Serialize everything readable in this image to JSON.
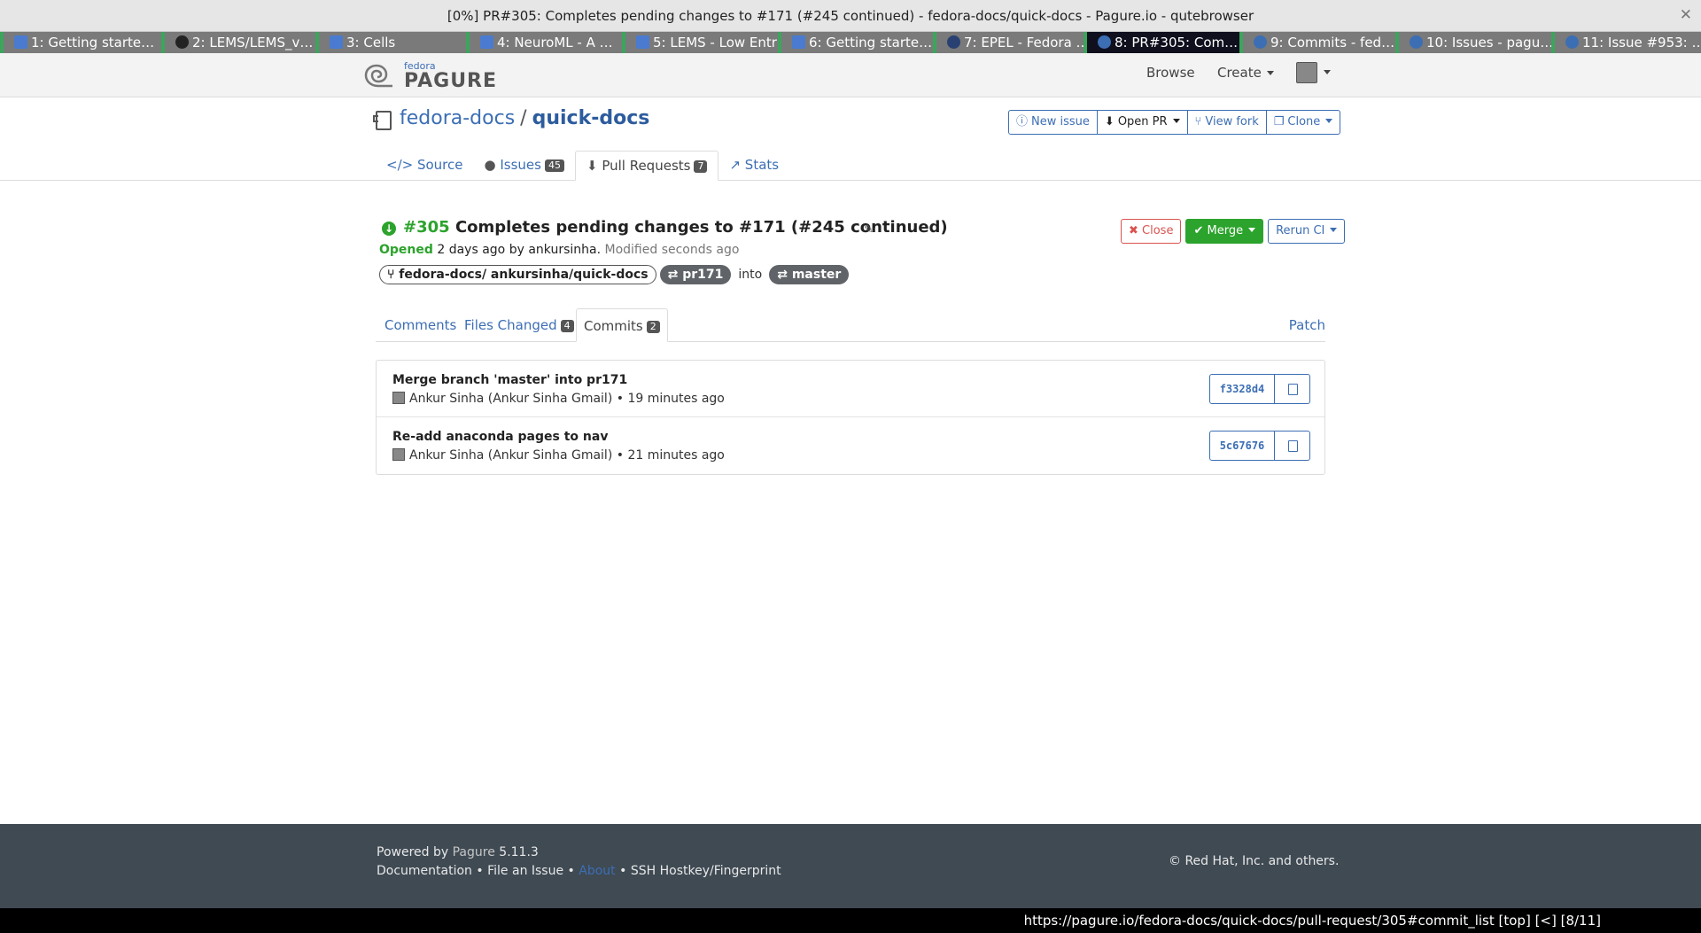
{
  "window": {
    "title": "[0%] PR#305: Completes pending changes to #171 (#245 continued) - fedora-docs/quick-docs - Pagure.io - qutebrowser",
    "close_glyph": "✕"
  },
  "tabs": [
    {
      "label": "1: Getting starte…",
      "icon": "neuroml-icon",
      "color": "#4a7bd0",
      "active": false
    },
    {
      "label": "2: LEMS/LEMS_v…",
      "icon": "github-icon",
      "color": "#222222",
      "active": false
    },
    {
      "label": "3: Cells",
      "icon": "neuroml-icon",
      "color": "#4a7bd0",
      "active": false
    },
    {
      "label": "4: NeuroML - A …",
      "icon": "neuroml-icon",
      "color": "#4a7bd0",
      "active": false
    },
    {
      "label": "5: LEMS - Low Entr…",
      "icon": "neuroml-icon",
      "color": "#4a7bd0",
      "active": false
    },
    {
      "label": "6: Getting starte…",
      "icon": "neuroml-icon",
      "color": "#4a7bd0",
      "active": false
    },
    {
      "label": "7: EPEL - Fedora …",
      "icon": "fedora-icon",
      "color": "#294172",
      "active": false
    },
    {
      "label": "8: PR#305: Com…",
      "icon": "pagure-icon",
      "color": "#3c6eb4",
      "active": true
    },
    {
      "label": "9: Commits - fed…",
      "icon": "pagure-icon",
      "color": "#3c6eb4",
      "active": false
    },
    {
      "label": "10: Issues - pagu…",
      "icon": "pagure-icon",
      "color": "#3c6eb4",
      "active": false
    },
    {
      "label": "11: Issue #953: …",
      "icon": "pagure-icon",
      "color": "#3c6eb4",
      "active": false
    }
  ],
  "nav": {
    "logo_small": "fedora",
    "logo_big": "PAGURE",
    "browse": "Browse",
    "create": "Create"
  },
  "repo": {
    "namespace": "fedora-docs",
    "separator": "/",
    "name": "quick-docs",
    "buttons": {
      "new_issue": "New issue",
      "open_pr": "Open PR",
      "view_fork": "View fork",
      "clone": "Clone"
    },
    "tabs": {
      "source": "Source",
      "issues": "Issues",
      "issues_count": "45",
      "pull_requests": "Pull Requests",
      "pull_requests_count": "7",
      "stats": "Stats"
    }
  },
  "pr": {
    "number": "#305",
    "title": "Completes pending changes to #171 (#245 continued)",
    "opened_label": "Opened",
    "opened_text": "2 days ago by ankursinha.",
    "modified_text": "Modified seconds ago",
    "source_repo": "fedora-docs/ ankursinha/quick-docs",
    "source_branch": "pr171",
    "into": "into",
    "target_branch": "master",
    "actions": {
      "close": "Close",
      "merge": "Merge",
      "rerun": "Rerun CI"
    },
    "subtabs": {
      "comments": "Comments",
      "files_changed": "Files Changed",
      "files_changed_count": "4",
      "commits": "Commits",
      "commits_count": "2",
      "patch": "Patch"
    }
  },
  "commits": [
    {
      "message": "Merge branch 'master' into pr171",
      "author": "Ankur Sinha (Ankur Sinha Gmail) • 19 minutes ago",
      "hash": "f3328d4"
    },
    {
      "message": "Re-add anaconda pages to nav",
      "author": "Ankur Sinha (Ankur Sinha Gmail) • 21 minutes ago",
      "hash": "5c67676"
    }
  ],
  "footer": {
    "powered_prefix": "Powered by",
    "powered_name": "Pagure",
    "version": "5.11.3",
    "documentation": "Documentation",
    "file_issue": "File an Issue",
    "about": "About",
    "ssh": "SSH Hostkey/Fingerprint",
    "bullet": "•",
    "copyright": "© Red Hat, Inc. and others."
  },
  "statusbar": {
    "url": "https://pagure.io/fedora-docs/quick-docs/pull-request/305#commit_list [top] [<] [8/11]"
  }
}
